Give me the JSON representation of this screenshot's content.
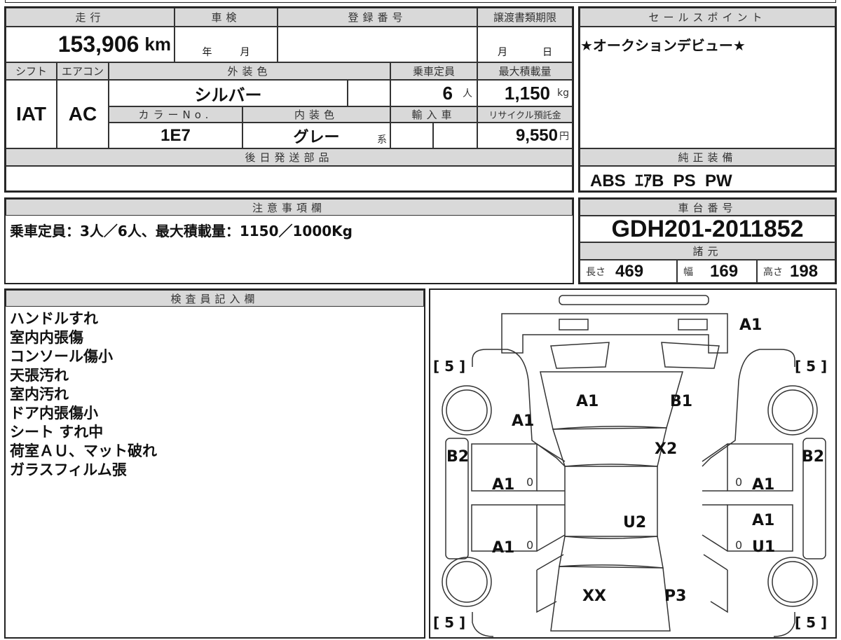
{
  "mileage": {
    "label": "走行",
    "value": "153,906",
    "unit": "km"
  },
  "shaken": {
    "label": "車検",
    "year": "年",
    "month": "月"
  },
  "registration": {
    "label": "登録番号",
    "value": ""
  },
  "transfer_deadline": {
    "label": "譲渡書類期限",
    "month": "月",
    "day": "日"
  },
  "shift": {
    "label": "シフト",
    "value": "IAT"
  },
  "aircon": {
    "label": "エアコン",
    "value": "AC"
  },
  "exterior_color": {
    "label": "外装色",
    "value": "シルバー"
  },
  "capacity": {
    "label": "乗車定員",
    "value": "6",
    "unit": "人"
  },
  "max_load": {
    "label": "最大積載量",
    "value": "1,150",
    "unit": "kg"
  },
  "color_no": {
    "label": "カラーNo.",
    "value": "1E7"
  },
  "interior_color": {
    "label": "内装色",
    "value": "グレー",
    "suffix": "系"
  },
  "import": {
    "label": "輸入車"
  },
  "recycle": {
    "label": "リサイクル預託金",
    "value": "9,550",
    "unit": "円"
  },
  "later_parts": {
    "label": "後日発送部品",
    "value": ""
  },
  "sales_point": {
    "label": "セールスポイント",
    "value": "★オークションデビュー★"
  },
  "equipment": {
    "label": "純正装備",
    "value": "ABS  ｴｱB  PS  PW"
  },
  "notes": {
    "label": "注意事項欄",
    "value": "乗車定員：3人／6人、最大積載量：1150／1000Kg"
  },
  "chassis": {
    "label": "車台番号",
    "value": "GDH201-2011852"
  },
  "specs": {
    "label": "諸元",
    "length_label": "長さ",
    "length": "469",
    "width_label": "幅",
    "width": "169",
    "height_label": "高さ",
    "height": "198"
  },
  "inspector": {
    "label": "検査員記入欄",
    "lines": [
      "ハンドルすれ",
      "室内内張傷",
      "コンソール傷小",
      "天張汚れ",
      "室内汚れ",
      "ドア内張傷小",
      "シート すれ中",
      "荷室ＡＵ、マット破れ",
      "ガラスフィルム張"
    ]
  },
  "diagram": {
    "marks": {
      "front_bumper": "A1",
      "hood_left": "A1",
      "hood_right": "B1",
      "left_front_fender": "A1",
      "windshield": "X2",
      "left_sill": "B2",
      "right_sill": "B2",
      "left_front_door": "A1",
      "right_front_door": "A1",
      "roof": "U2",
      "right_rear_door_1": "A1",
      "right_rear_door_2": "U1",
      "left_rear_door": "A1",
      "rear_left": "XX",
      "rear_right": "P3"
    },
    "tires": [
      "[ 5 ]",
      "[ 5 ]",
      "[ 5 ]",
      "[ 5 ]"
    ],
    "zeros": [
      "0",
      "0",
      "0",
      "0"
    ]
  }
}
